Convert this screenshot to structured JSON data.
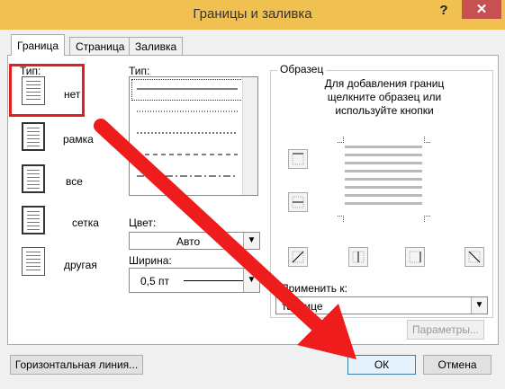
{
  "window": {
    "title": "Границы и заливка",
    "help": "?",
    "close": "✕"
  },
  "tabs": [
    {
      "label": "Граница",
      "active": true
    },
    {
      "label": "Страница",
      "active": false
    },
    {
      "label": "Заливка",
      "active": false
    }
  ],
  "setting": {
    "group_label": "Тип:",
    "items": [
      {
        "label": "нет"
      },
      {
        "label": "рамка"
      },
      {
        "label": "все"
      },
      {
        "label": "сетка"
      },
      {
        "label": "другая"
      }
    ]
  },
  "style": {
    "label": "Тип:",
    "color_label": "Цвет:",
    "color_value": "Авто",
    "width_label": "Ширина:",
    "width_value": "0,5 пт"
  },
  "preview": {
    "group_label": "Образец",
    "hint": "Для добавления границ щелкните образец или используйте кнопки",
    "apply_label": "Применить к:",
    "apply_value": "таблице",
    "options_button": "Параметры..."
  },
  "footer": {
    "hline_button": "Горизонтальная линия...",
    "ok_button": "ОК",
    "cancel_button": "Отмена"
  },
  "colors": {
    "title_bar": "#f0c050",
    "close_button": "#c75050",
    "highlight": "#e02020"
  }
}
